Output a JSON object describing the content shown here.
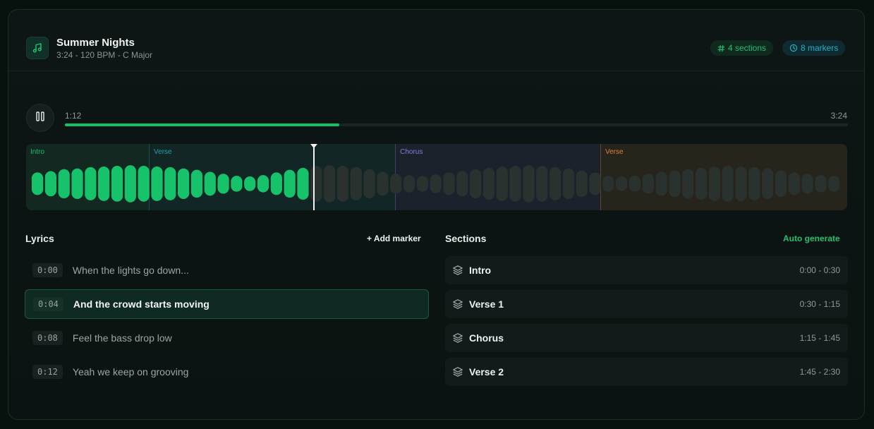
{
  "song": {
    "title": "Summer Nights",
    "meta": "3:24 - 120 BPM - C Major"
  },
  "badges": {
    "sections": "4 sections",
    "markers": "8 markers"
  },
  "badge_icons": [
    "hash-icon",
    "clock-icon"
  ],
  "player": {
    "current_time": "1:12",
    "total_time": "3:24",
    "progress": 0.35,
    "play_state_icon": "pause-icon"
  },
  "waveform": {
    "regions": [
      {
        "label": "Intro",
        "start": 0.0,
        "end": 0.1495,
        "color": "#1fbf6a"
      },
      {
        "label": "Verse",
        "start": 0.1495,
        "end": 0.4494,
        "color": "#1aa8a8"
      },
      {
        "label": "Chorus",
        "start": 0.4494,
        "end": 0.6993,
        "color": "#8a7be0"
      },
      {
        "label": "Verse",
        "start": 0.6993,
        "end": 1.0,
        "color": "#e07f3a"
      }
    ],
    "playhead": 0.3505,
    "played_color": "#16c36b",
    "unplayed_color": "#2a3230",
    "amplitudes": [
      0.34,
      0.38,
      0.44,
      0.46,
      0.5,
      0.52,
      0.54,
      0.56,
      0.54,
      0.52,
      0.5,
      0.46,
      0.42,
      0.36,
      0.3,
      0.24,
      0.22,
      0.26,
      0.34,
      0.42,
      0.48,
      0.54,
      0.56,
      0.54,
      0.5,
      0.44,
      0.36,
      0.3,
      0.26,
      0.24,
      0.28,
      0.34,
      0.38,
      0.44,
      0.48,
      0.52,
      0.54,
      0.56,
      0.54,
      0.5,
      0.46,
      0.4,
      0.34,
      0.24,
      0.22,
      0.24,
      0.3,
      0.36,
      0.4,
      0.44,
      0.48,
      0.52,
      0.54,
      0.52,
      0.5,
      0.46,
      0.4,
      0.34,
      0.3,
      0.26,
      0.24
    ]
  },
  "lyrics": {
    "heading": "Lyrics",
    "add_marker_label": "+ Add marker",
    "items": [
      {
        "time": "0:00",
        "text": "When the lights go down..."
      },
      {
        "time": "0:04",
        "text": "And the crowd starts moving"
      },
      {
        "time": "0:08",
        "text": "Feel the bass drop low"
      },
      {
        "time": "0:12",
        "text": "Yeah we keep on grooving"
      }
    ],
    "active_index": 1
  },
  "sections": {
    "heading": "Sections",
    "auto_generate_label": "Auto generate",
    "items": [
      {
        "name": "Intro",
        "range": "0:00 - 0:30"
      },
      {
        "name": "Verse 1",
        "range": "0:30 - 1:15"
      },
      {
        "name": "Chorus",
        "range": "1:15 - 1:45"
      },
      {
        "name": "Verse 2",
        "range": "1:45 - 2:30"
      }
    ]
  }
}
